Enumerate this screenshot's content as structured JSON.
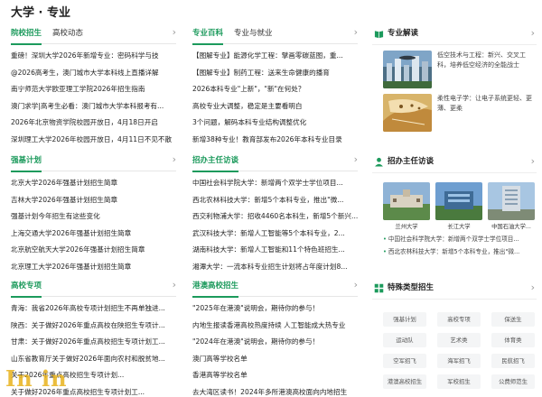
{
  "page_title": "大学 · 专业",
  "col_a": {
    "sections": [
      {
        "tabs": [
          {
            "label": "院校招生",
            "active": true
          },
          {
            "label": "高校动态",
            "active": false
          }
        ],
        "items": [
          "重磅！深圳大学2026年新增专业：密码科学与技",
          "@2026高考生，澳门城市大学本科线上直播详解",
          "南宁师范大学欧亚理工学院2026年招生指南",
          "澳门求学|高考生必看：澳门城市大学本科报考有...",
          "2026年北京物资学院校园开放日，4月18日开启",
          "深圳理工大学2026年校园开放日，4月11日不见不散"
        ]
      },
      {
        "tabs": [
          {
            "label": "强基计划",
            "active": true
          }
        ],
        "items": [
          "北京大学2026年强基计划招生简章",
          "吉林大学2026年强基计划招生简章",
          "强基计划今年招生有这些变化",
          "上海交通大学2026年强基计划招生简章",
          "北京航空航天大学2026年强基计划招生简章",
          "北京理工大学2026年强基计划招生简章"
        ]
      },
      {
        "tabs": [
          {
            "label": "高校专项",
            "active": true
          }
        ],
        "items": [
          "青海：我省2026年高校专项计划招生不再单独进...",
          "陕西：关于做好2026年重点高校在陕招生专项计...",
          "甘肃：关于做好2026年重点高校招生专项计划工...",
          "山东省教育厅关于做好2026年面向农村和脱贫地...",
          "关于2026年重点高校招生专项计划...",
          "关于做好2026年重点高校招生专项计划工..."
        ]
      }
    ]
  },
  "col_b": {
    "sections": [
      {
        "tabs": [
          {
            "label": "专业百科",
            "active": true
          },
          {
            "label": "专业与就业",
            "active": false
          }
        ],
        "items": [
          "【图解专业】能源化学工程：擘画零碳蓝图，重...",
          "【图解专业】制药工程：送来生命健康的播育",
          "2026本科专业\"上新\"，\"新\"在何处？",
          "高校专业大调整，稳定是主要看明白",
          "3个问题，解码本科专业结构调整优化",
          "新增38种专业！教育部发布2026年本科专业目录"
        ]
      },
      {
        "tabs": [
          {
            "label": "招办主任访谈",
            "active": true
          }
        ],
        "items": [
          "中国社会科学院大学：新增两个双学士学位项目...",
          "西北农林科技大学：新增5个本科专业，推出\"微...",
          "西交利物浦大学：招收4460名本科生，新增5个新兴...",
          "武汉科技大学：新增人工智能等5个本科专业，2...",
          "湖南科技大学：新增人工智能和11个特色班招生...",
          "湘潭大学：一流本科专业招生计划将占年度计划8..."
        ]
      },
      {
        "tabs": [
          {
            "label": "港澳高校招生",
            "active": true
          }
        ],
        "items": [
          "\"2025年在港澳\"说明会，期待你的参与！",
          "内地生报读香港高校热度持续 人工智能成大热专业",
          "\"2024年在港澳\"说明会，期待你的参与！",
          "澳门高等学校名单",
          "香港高等学校名单",
          "去大湾区读书！2024年多所港澳高校面向内地招生"
        ]
      }
    ]
  },
  "sidebar": {
    "analysis": {
      "title": "专业解读",
      "items": [
        {
          "text": "低空技术与工程：新兴、交叉工科，培养低空经济的全能战士"
        },
        {
          "text": "柔性电子学：让电子系统更轻、更薄、更柔"
        }
      ]
    },
    "interviews": {
      "title": "招办主任访谈",
      "photos": [
        {
          "caption": "兰州大学"
        },
        {
          "caption": "长江大学"
        },
        {
          "caption": "中国石油大学..."
        }
      ],
      "news": [
        "中国社会科学院大学：新增两个双学士学位项目...",
        "西北农林科技大学：新增5个本科专业，推出\"微..."
      ]
    },
    "special": {
      "title": "特殊类型招生",
      "tags": [
        "强基计划",
        "高校专项",
        "保送生",
        "运动队",
        "艺术类",
        "体育类",
        "空军招飞",
        "海军招飞",
        "民航招飞",
        "港澳高校招生",
        "军校招生",
        "公费师范生"
      ]
    }
  },
  "colors": {
    "accent": "#1c9a5c",
    "tag_bg": "#f4f5f6",
    "divider": "#e6e6e6"
  },
  "icons": {
    "more": "chevron-right-icon",
    "analysis": "open-book-icon",
    "interviews": "user-icon",
    "special": "grid-icon"
  },
  "watermark": "In in"
}
